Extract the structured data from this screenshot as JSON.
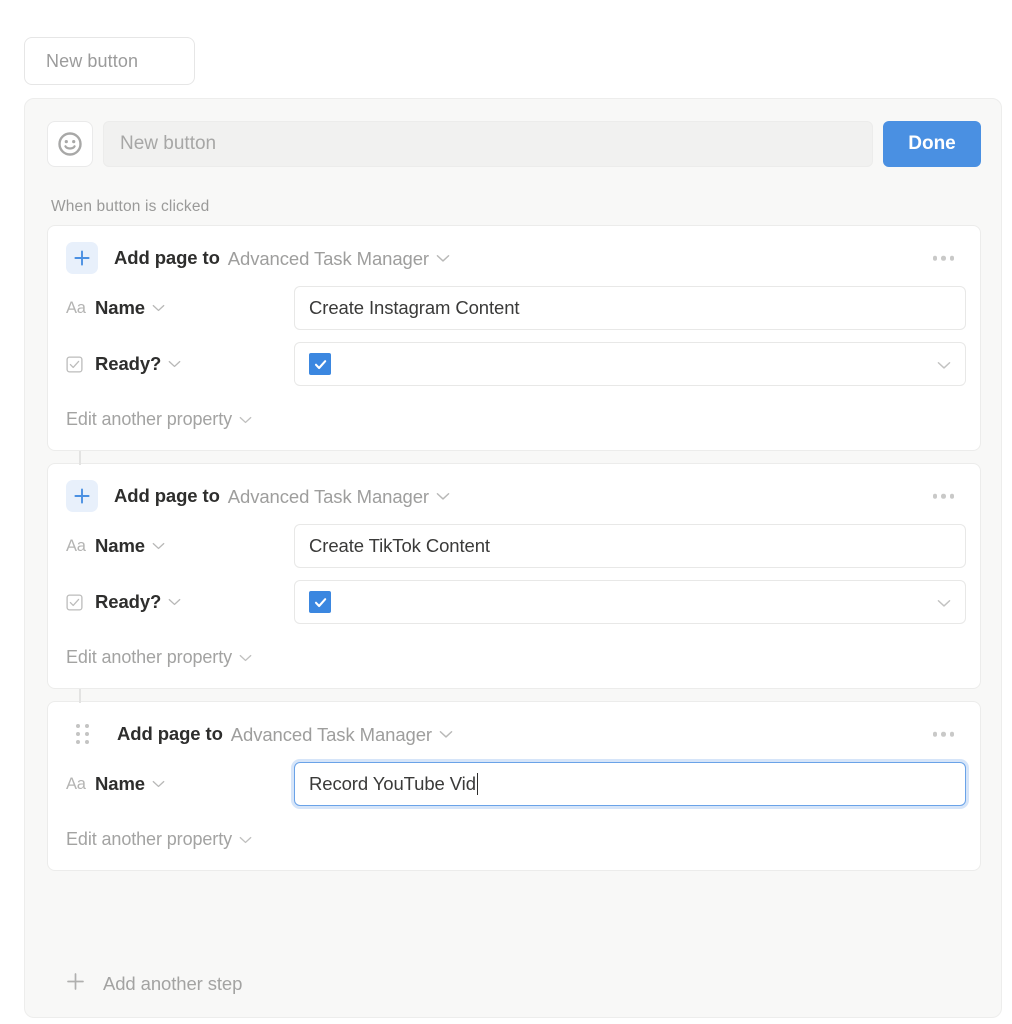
{
  "top_chip": {
    "label": "New button"
  },
  "panel": {
    "header": {
      "emoji_icon": "smiley-face-icon",
      "title_value": "",
      "title_placeholder": "New button",
      "done_label": "Done",
      "done_color": "#4a90e2"
    },
    "trigger_caption": "When button is clicked",
    "add_step_label": "Add another step",
    "add_step_icon": "plus-icon"
  },
  "steps": [
    {
      "leading_icon": "plus-icon",
      "title": "Add page to",
      "target": "Advanced Task Manager",
      "target_chevron_icon": "chevron-down-icon",
      "overflow_icon": "more-horizontal-icon",
      "properties": [
        {
          "type_icon": "text-property-icon",
          "type_glyph": "Aa",
          "name": "Name",
          "name_chevron_icon": "chevron-down-icon",
          "value_kind": "text",
          "value": "Create Instagram Content",
          "focused": false,
          "has_value_chevron": false
        },
        {
          "type_icon": "checkbox-property-icon",
          "type_glyph": "",
          "name": "Ready?",
          "name_chevron_icon": "chevron-down-icon",
          "value_kind": "checkbox",
          "value": "",
          "checked": true,
          "focused": false,
          "has_value_chevron": true
        }
      ],
      "edit_another_label": "Edit another property",
      "edit_another_chevron_icon": "chevron-down-icon",
      "has_connector": false
    },
    {
      "leading_icon": "plus-icon",
      "title": "Add page to",
      "target": "Advanced Task Manager",
      "target_chevron_icon": "chevron-down-icon",
      "overflow_icon": "more-horizontal-icon",
      "properties": [
        {
          "type_icon": "text-property-icon",
          "type_glyph": "Aa",
          "name": "Name",
          "name_chevron_icon": "chevron-down-icon",
          "value_kind": "text",
          "value": "Create TikTok Content",
          "focused": false,
          "has_value_chevron": false
        },
        {
          "type_icon": "checkbox-property-icon",
          "type_glyph": "",
          "name": "Ready?",
          "name_chevron_icon": "chevron-down-icon",
          "value_kind": "checkbox",
          "value": "",
          "checked": true,
          "focused": false,
          "has_value_chevron": true
        }
      ],
      "edit_another_label": "Edit another property",
      "edit_another_chevron_icon": "chevron-down-icon",
      "has_connector": true
    },
    {
      "leading_icon": "drag-handle-icon",
      "title": "Add page to",
      "target": "Advanced Task Manager",
      "target_chevron_icon": "chevron-down-icon",
      "overflow_icon": "more-horizontal-icon",
      "properties": [
        {
          "type_icon": "text-property-icon",
          "type_glyph": "Aa",
          "name": "Name",
          "name_chevron_icon": "chevron-down-icon",
          "value_kind": "text",
          "value": "Record YouTube Vid",
          "focused": true,
          "has_value_chevron": false
        }
      ],
      "edit_another_label": "Edit another property",
      "edit_another_chevron_icon": "chevron-down-icon",
      "has_connector": true
    }
  ],
  "colors": {
    "accent_blue": "#3b87e0",
    "done_blue": "#4a90e2",
    "icon_tint_bg": "#e8f0fb",
    "panel_bg": "#f8f8f7",
    "card_bg": "#ffffff",
    "muted_text": "#9e9e9d"
  }
}
